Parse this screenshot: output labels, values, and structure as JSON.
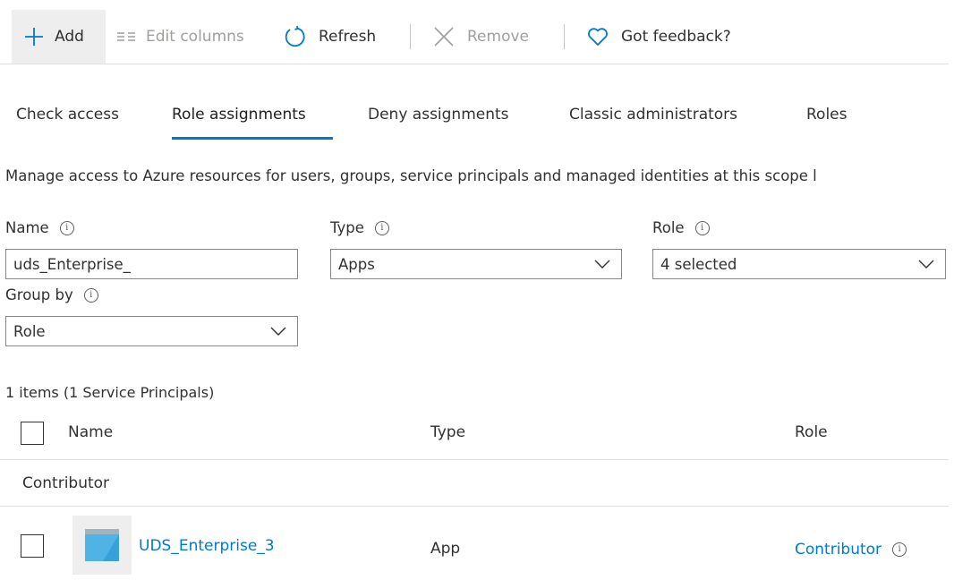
{
  "toolbar": {
    "add_label": "Add",
    "edit_columns_label": "Edit columns",
    "refresh_label": "Refresh",
    "remove_label": "Remove",
    "feedback_label": "Got feedback?"
  },
  "tabs": [
    {
      "label": "Check access"
    },
    {
      "label": "Role assignments",
      "active": true
    },
    {
      "label": "Deny assignments"
    },
    {
      "label": "Classic administrators"
    },
    {
      "label": "Roles"
    }
  ],
  "description": "Manage access to Azure resources for users, groups, service principals and managed identities at this scope l",
  "filters": {
    "name": {
      "label": "Name",
      "value": "uds_Enterprise_"
    },
    "type": {
      "label": "Type",
      "value": "Apps"
    },
    "role": {
      "label": "Role",
      "value": "4 selected"
    },
    "group_by": {
      "label": "Group by",
      "value": "Role"
    }
  },
  "info_glyph": "i",
  "results": {
    "count_text": "1 items (1 Service Principals)",
    "columns": [
      "Name",
      "Type",
      "Role"
    ],
    "groups": [
      {
        "label": "Contributor",
        "rows": [
          {
            "name": "UDS_Enterprise_3",
            "type": "App",
            "role": "Contributor"
          }
        ]
      }
    ]
  },
  "colors": {
    "accent": "#0078d4",
    "text": "#323130",
    "disabled": "#a19f9d",
    "app_icon": "#4fb3e6"
  }
}
